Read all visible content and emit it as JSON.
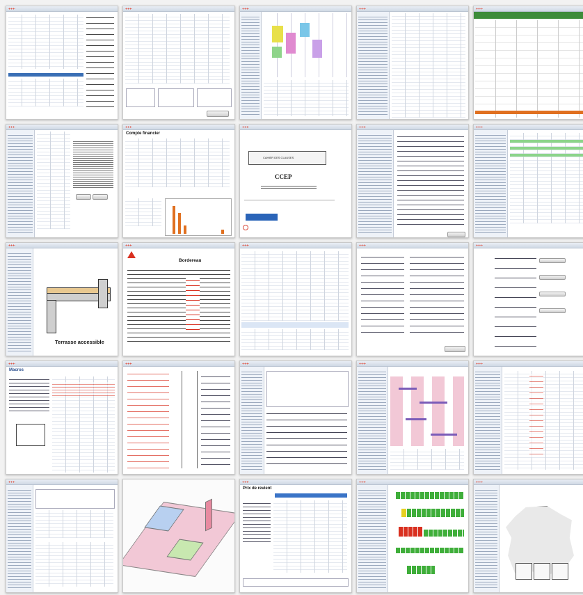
{
  "page": {
    "background": "#f2f2f2"
  },
  "tiles": {
    "r3c1": {
      "caption": "Terrasse accessible"
    },
    "r2c3": {
      "acronym": "CCEP",
      "heading": "CAHIER DES CLAUSES"
    },
    "r3c2": {
      "title": "Bordereau"
    },
    "r4c1": {
      "title": "Macros"
    },
    "r2c2": {
      "title": "Compte financier"
    },
    "r5c3": {
      "title": "Prix de revient"
    }
  },
  "colors": {
    "green_header": "#3d8c3a",
    "accent_orange": "#e07020",
    "bar_red": "#d93020",
    "bar_green": "#3fae3a",
    "bar_yellow": "#e8d020",
    "gantt_pink": "#f2c8d6",
    "gantt_purple": "#7b5cb8"
  }
}
